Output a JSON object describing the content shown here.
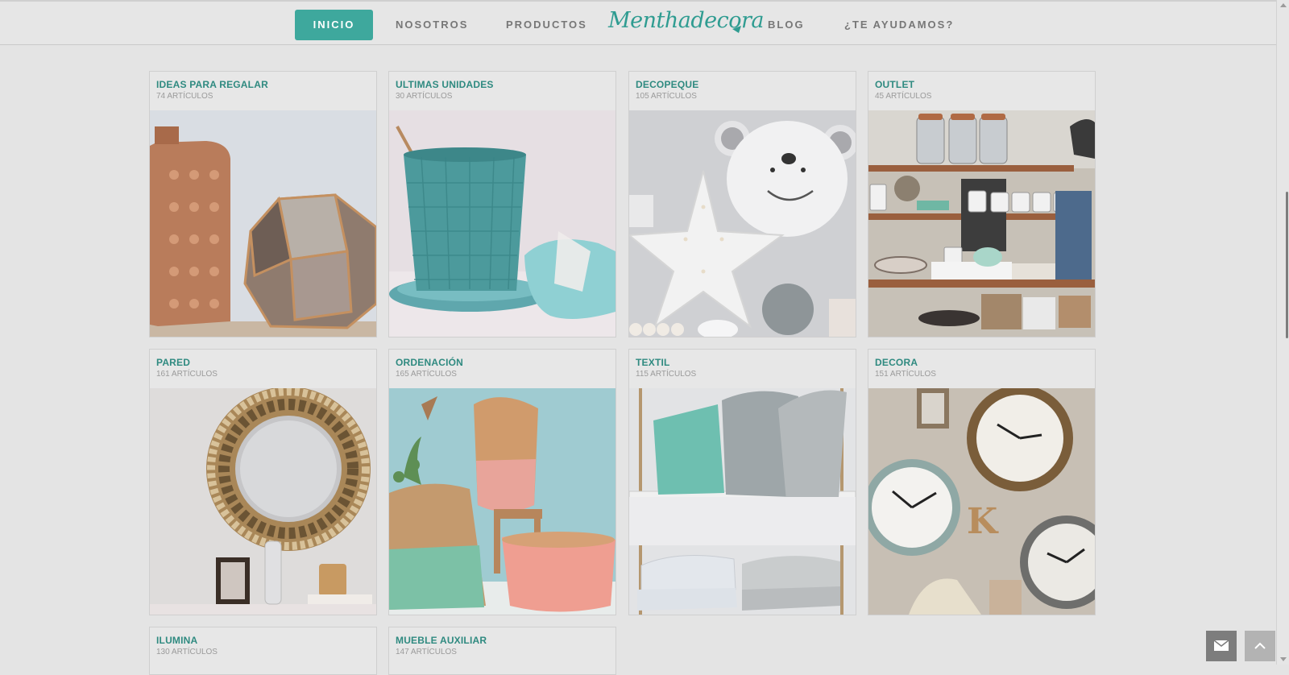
{
  "nav": {
    "items": [
      {
        "label": "INICIO",
        "active": true
      },
      {
        "label": "NOSOTROS",
        "active": false
      },
      {
        "label": "PRODUCTOS",
        "active": false
      },
      {
        "label": "BLOG",
        "active": false
      },
      {
        "label": "¿TE AYUDAMOS?",
        "active": false
      }
    ],
    "logo": "Menthadecora"
  },
  "colors": {
    "accent": "#3ea89d",
    "title": "#2f8a80",
    "background": "#e4e4e4"
  },
  "categories": [
    {
      "title": "IDEAS PARA REGALAR",
      "count": "74 ARTÍCULOS",
      "image": "copper lanterns"
    },
    {
      "title": "ULTIMAS UNIDADES",
      "count": "30 ARTÍCULOS",
      "image": "teal planter"
    },
    {
      "title": "DECOPEQUE",
      "count": "105 ARTÍCULOS",
      "image": "bear head and star lamp"
    },
    {
      "title": "OUTLET",
      "count": "45 ARTÍCULOS",
      "image": "kitchen shelves"
    },
    {
      "title": "PARED",
      "count": "161 ARTÍCULOS",
      "image": "sunburst mirror"
    },
    {
      "title": "ORDENACIÓN",
      "count": "165 ARTÍCULOS",
      "image": "woven baskets"
    },
    {
      "title": "TEXTIL",
      "count": "115 ARTÍCULOS",
      "image": "cushions on shelves"
    },
    {
      "title": "DECORA",
      "count": "151 ARTÍCULOS",
      "image": "wall clocks"
    },
    {
      "title": "ILUMINA",
      "count": "130 ARTÍCULOS",
      "image": ""
    },
    {
      "title": "MUEBLE AUXILIAR",
      "count": "147 ARTÍCULOS",
      "image": ""
    }
  ],
  "floating": {
    "mail_icon": "envelope-icon",
    "top_icon": "chevron-up-icon"
  }
}
